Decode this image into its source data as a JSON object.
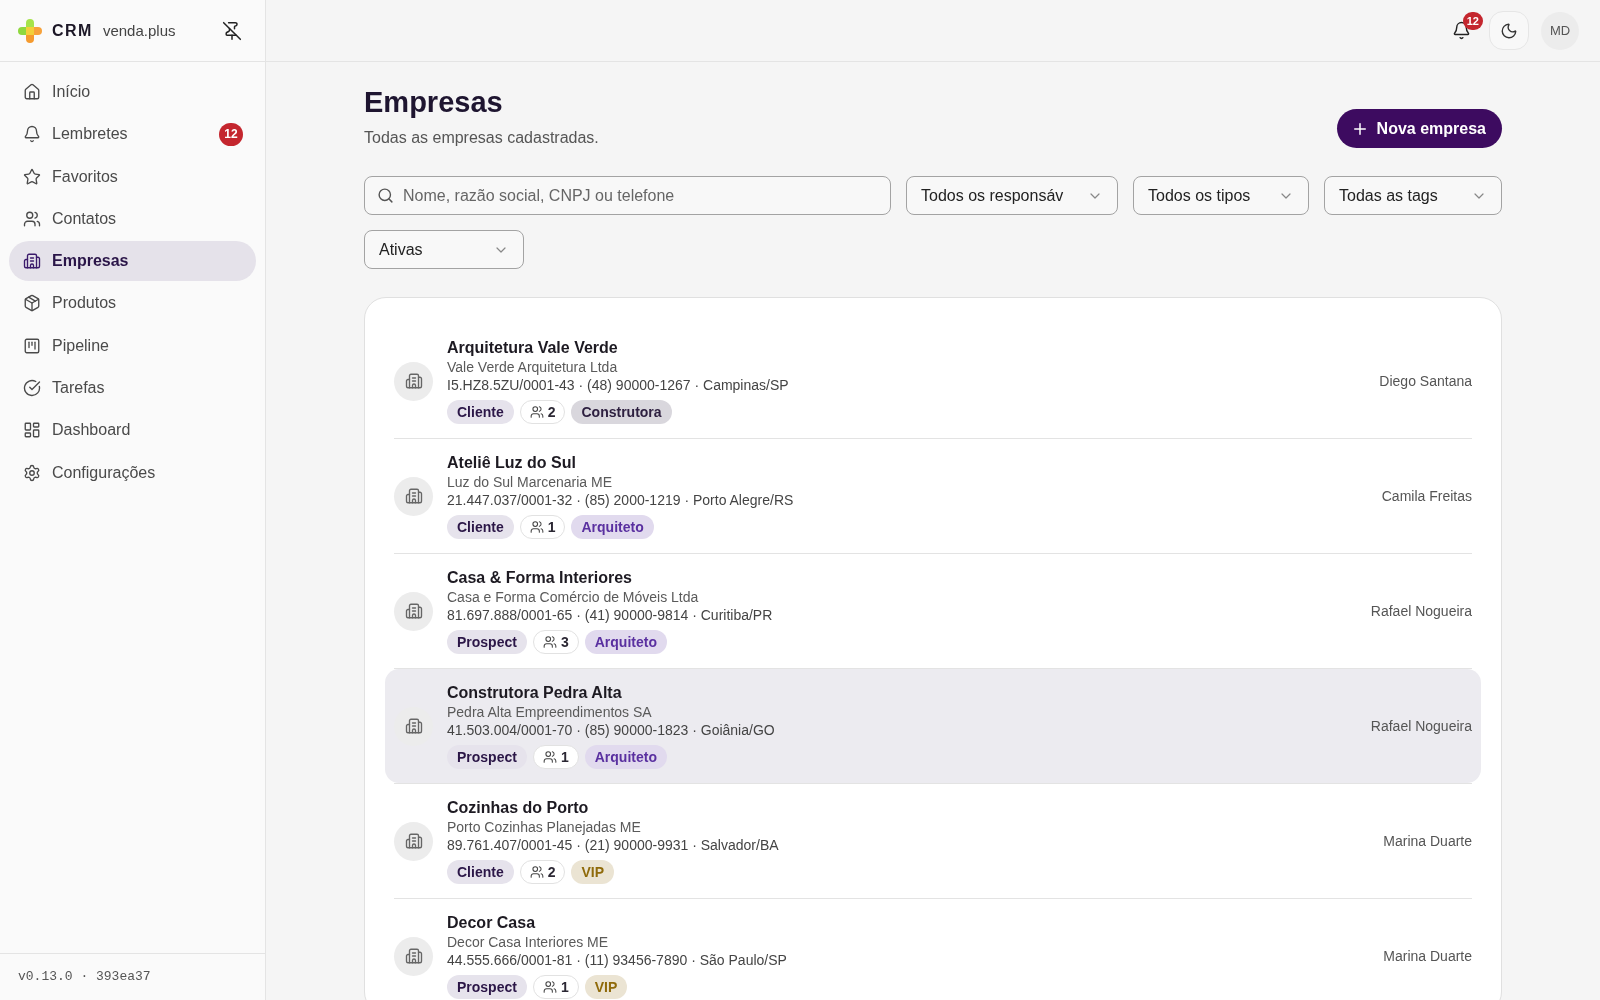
{
  "sidebar": {
    "brand": {
      "name": "CRM",
      "domain": "venda.plus"
    },
    "nav": [
      {
        "label": "Início",
        "selected": false
      },
      {
        "label": "Lembretes",
        "selected": false,
        "badge": "12"
      },
      {
        "label": "Favoritos",
        "selected": false
      },
      {
        "label": "Contatos",
        "selected": false
      },
      {
        "label": "Empresas",
        "selected": true
      },
      {
        "label": "Produtos",
        "selected": false
      },
      {
        "label": "Pipeline",
        "selected": false
      },
      {
        "label": "Tarefas",
        "selected": false
      },
      {
        "label": "Dashboard",
        "selected": false
      },
      {
        "label": "Configurações",
        "selected": false
      }
    ],
    "footer": "v0.13.0 · 393ea37"
  },
  "topbar": {
    "notifications": "12",
    "avatar": "MD"
  },
  "page": {
    "title": "Empresas",
    "subtitle": "Todas as empresas cadastradas.",
    "action": "Nova empresa"
  },
  "filters": {
    "search": {
      "placeholder": "Nome, razão social, CNPJ ou telefone"
    },
    "dropdowns": [
      {
        "value": "Todos os responsáv"
      },
      {
        "value": "Todos os tipos"
      },
      {
        "value": "Todas as tags"
      },
      {
        "value": "Ativas"
      }
    ]
  },
  "companies": [
    {
      "name": "Arquitetura Vale Verde",
      "legal_name": "Vale Verde Arquitetura Ltda",
      "details": "I5.HZ8.5ZU/0001-43 · (48) 90000-1267 · Campinas/SP",
      "type": "Cliente",
      "contacts": "2",
      "tags": [
        {
          "label": "Construtora",
          "color": "#2e2040"
        }
      ],
      "owner": "Diego Santana",
      "selected": false
    },
    {
      "name": "Ateliê Luz do Sul",
      "legal_name": "Luz do Sul Marcenaria ME",
      "details": "21.447.037/0001-32 · (85) 2000-1219 · Porto Alegre/RS",
      "type": "Cliente",
      "contacts": "1",
      "tags": [
        {
          "label": "Arquiteto",
          "color": "#5a30a0"
        }
      ],
      "owner": "Camila Freitas",
      "selected": false
    },
    {
      "name": "Casa & Forma Interiores",
      "legal_name": "Casa e Forma Comércio de Móveis Ltda",
      "details": "81.697.888/0001-65 · (41) 90000-9814 · Curitiba/PR",
      "type": "Prospect",
      "contacts": "3",
      "tags": [
        {
          "label": "Arquiteto",
          "color": "#5a30a0"
        }
      ],
      "owner": "Rafael Nogueira",
      "selected": false
    },
    {
      "name": "Construtora Pedra Alta",
      "legal_name": "Pedra Alta Empreendimentos SA",
      "details": "41.503.004/0001-70 · (85) 90000-1823 · Goiânia/GO",
      "type": "Prospect",
      "contacts": "1",
      "tags": [
        {
          "label": "Arquiteto",
          "color": "#5a30a0"
        }
      ],
      "owner": "Rafael Nogueira",
      "selected": true
    },
    {
      "name": "Cozinhas do Porto",
      "legal_name": "Porto Cozinhas Planejadas ME",
      "details": "89.761.407/0001-45 · (21) 90000-9931 · Salvador/BA",
      "type": "Cliente",
      "contacts": "2",
      "tags": [
        {
          "label": "VIP",
          "color": "#8f6a0a"
        }
      ],
      "owner": "Marina Duarte",
      "selected": false
    },
    {
      "name": "Decor Casa",
      "legal_name": "Decor Casa Interiores ME",
      "details": "44.555.666/0001-81 · (11) 93456-7890 · São Paulo/SP",
      "type": "Prospect",
      "contacts": "1",
      "tags": [
        {
          "label": "VIP",
          "color": "#8f6a0a"
        }
      ],
      "owner": "Marina Duarte",
      "selected": false
    }
  ]
}
